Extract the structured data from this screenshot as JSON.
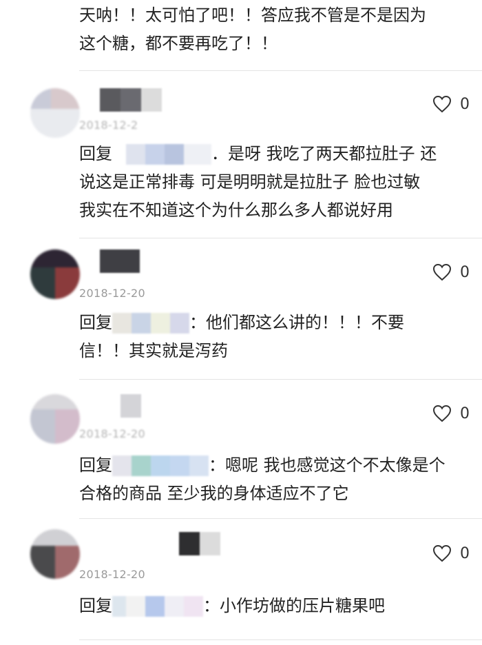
{
  "top_comment": {
    "line1": "天呐！！太可怕了吧！！答应我不管是不是因为",
    "line2": "这个糖，都不要再吃了！！"
  },
  "comments": [
    {
      "date": "2018-12-2",
      "likes": "0",
      "reply_prefix": "回复",
      "reply_text_1": "．是呀 我吃了两天都拉肚子 还",
      "reply_text_2": "说这是正常排毒 可是明明就是拉肚子 脸也过敏",
      "reply_text_3": "我实在不知道这个为什么那么多人都说好用"
    },
    {
      "date": "2018-12-20",
      "likes": "0",
      "reply_prefix": "回复",
      "reply_text_1": "：他们都这么讲的！！！不要",
      "reply_text_2": "信！！其实就是泻药"
    },
    {
      "date": "2018-12-20",
      "likes": "0",
      "reply_prefix": "回复",
      "reply_text_1": "：嗯呢 我也感觉这个不太像是个",
      "reply_text_2": "合格的商品 至少我的身体适应不了它"
    },
    {
      "date": "2018-12-20",
      "likes": "0",
      "reply_prefix": "回复",
      "reply_text_1": "：小作坊做的压片糖果吧"
    }
  ],
  "icons": {
    "like": "heart-outline-icon"
  },
  "colors": {
    "text": "#222222",
    "meta": "#9a9a9a",
    "divider": "#e4e4e4",
    "background": "#ffffff"
  }
}
